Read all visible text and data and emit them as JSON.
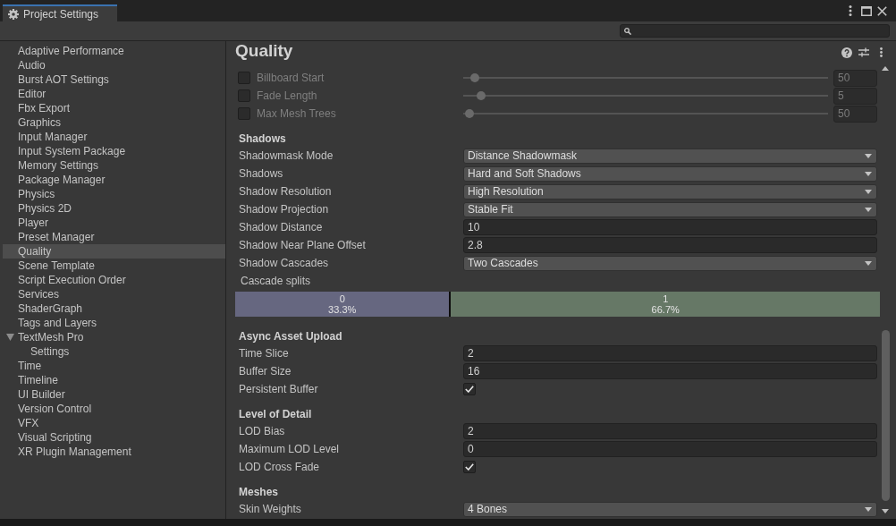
{
  "window": {
    "title": "Project Settings"
  },
  "sidebar": {
    "items": [
      {
        "label": "Adaptive Performance",
        "selected": false
      },
      {
        "label": "Audio",
        "selected": false
      },
      {
        "label": "Burst AOT Settings",
        "selected": false
      },
      {
        "label": "Editor",
        "selected": false
      },
      {
        "label": "Fbx Export",
        "selected": false
      },
      {
        "label": "Graphics",
        "selected": false
      },
      {
        "label": "Input Manager",
        "selected": false
      },
      {
        "label": "Input System Package",
        "selected": false
      },
      {
        "label": "Memory Settings",
        "selected": false
      },
      {
        "label": "Package Manager",
        "selected": false
      },
      {
        "label": "Physics",
        "selected": false
      },
      {
        "label": "Physics 2D",
        "selected": false
      },
      {
        "label": "Player",
        "selected": false
      },
      {
        "label": "Preset Manager",
        "selected": false
      },
      {
        "label": "Quality",
        "selected": true
      },
      {
        "label": "Scene Template",
        "selected": false
      },
      {
        "label": "Script Execution Order",
        "selected": false
      },
      {
        "label": "Services",
        "selected": false
      },
      {
        "label": "ShaderGraph",
        "selected": false
      },
      {
        "label": "Tags and Layers",
        "selected": false
      },
      {
        "label": "TextMesh Pro",
        "selected": false,
        "expanded": true,
        "children": [
          {
            "label": "Settings",
            "selected": false
          }
        ]
      },
      {
        "label": "Time",
        "selected": false
      },
      {
        "label": "Timeline",
        "selected": false
      },
      {
        "label": "UI Builder",
        "selected": false
      },
      {
        "label": "Version Control",
        "selected": false
      },
      {
        "label": "VFX",
        "selected": false
      },
      {
        "label": "Visual Scripting",
        "selected": false
      },
      {
        "label": "XR Plugin Management",
        "selected": false
      }
    ]
  },
  "page": {
    "title": "Quality"
  },
  "sections": [
    {
      "rows": [
        {
          "kind": "slider",
          "label": "Billboard Start",
          "checked": false,
          "disabled": true,
          "level": 0.02,
          "value": "50"
        },
        {
          "kind": "slider",
          "label": "Fade Length",
          "checked": false,
          "disabled": true,
          "level": 0.037,
          "value": "5"
        },
        {
          "kind": "slider",
          "label": "Max Mesh Trees",
          "checked": false,
          "disabled": true,
          "level": 0.004,
          "value": "50"
        }
      ]
    },
    {
      "heading": "Shadows",
      "rows": [
        {
          "kind": "dropdown",
          "label": "Shadowmask Mode",
          "value": "Distance Shadowmask"
        },
        {
          "kind": "dropdown",
          "label": "Shadows",
          "value": "Hard and Soft Shadows"
        },
        {
          "kind": "dropdown",
          "label": "Shadow Resolution",
          "value": "High Resolution"
        },
        {
          "kind": "dropdown",
          "label": "Shadow Projection",
          "value": "Stable Fit"
        },
        {
          "kind": "field",
          "label": "Shadow Distance",
          "value": "10"
        },
        {
          "kind": "field",
          "label": "Shadow Near Plane Offset",
          "value": "2.8"
        },
        {
          "kind": "dropdown",
          "label": "Shadow Cascades",
          "value": "Two Cascades"
        },
        {
          "kind": "splits",
          "label": "Cascade splits",
          "parts": [
            {
              "index": "0",
              "share": "33.3%",
              "level": 0.333,
              "color": "#666780"
            },
            {
              "index": "1",
              "share": "66.7%",
              "level": 0.667,
              "color": "#667866"
            }
          ]
        }
      ]
    },
    {
      "heading": "Async Asset Upload",
      "rows": [
        {
          "kind": "field",
          "label": "Time Slice",
          "value": "2"
        },
        {
          "kind": "field",
          "label": "Buffer Size",
          "value": "16"
        },
        {
          "kind": "checkbox",
          "label": "Persistent Buffer",
          "checked": true
        }
      ]
    },
    {
      "heading": "Level of Detail",
      "rows": [
        {
          "kind": "field",
          "label": "LOD Bias",
          "value": "2"
        },
        {
          "kind": "field",
          "label": "Maximum LOD Level",
          "value": "0"
        },
        {
          "kind": "checkbox",
          "label": "LOD Cross Fade",
          "checked": true
        }
      ]
    },
    {
      "heading": "Meshes",
      "rows": [
        {
          "kind": "dropdown",
          "label": "Skin Weights",
          "value": "4 Bones"
        }
      ]
    }
  ]
}
